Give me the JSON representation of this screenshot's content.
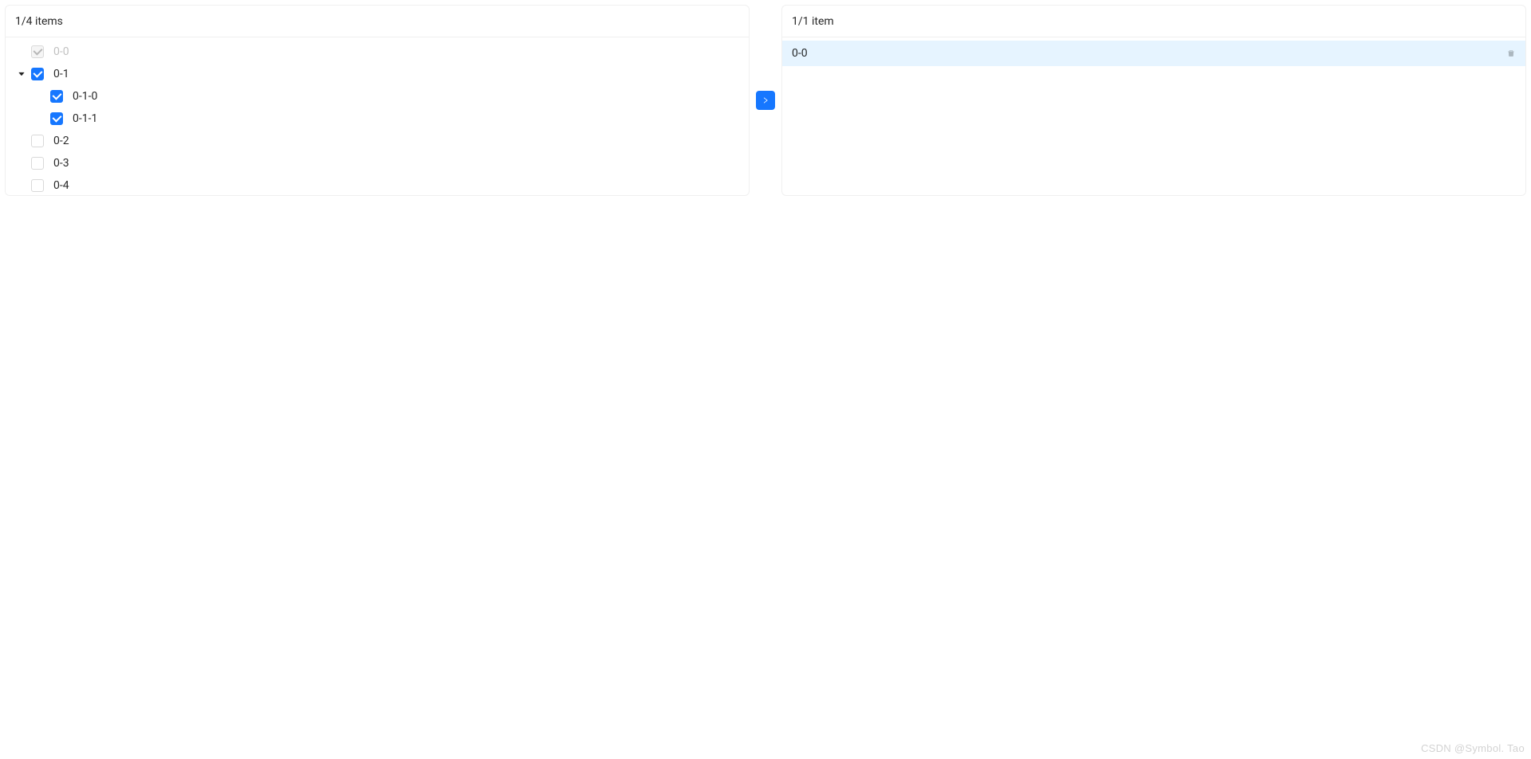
{
  "left": {
    "header": "1/4 items",
    "tree": [
      {
        "key": "0-0",
        "title": "0-0",
        "depth": 0,
        "switcher": "none",
        "checked": true,
        "disabled": true
      },
      {
        "key": "0-1",
        "title": "0-1",
        "depth": 0,
        "switcher": "open",
        "checked": true,
        "disabled": false
      },
      {
        "key": "0-1-0",
        "title": "0-1-0",
        "depth": 1,
        "switcher": "none",
        "checked": true,
        "disabled": false
      },
      {
        "key": "0-1-1",
        "title": "0-1-1",
        "depth": 1,
        "switcher": "none",
        "checked": true,
        "disabled": false
      },
      {
        "key": "0-2",
        "title": "0-2",
        "depth": 0,
        "switcher": "none",
        "checked": false,
        "disabled": false
      },
      {
        "key": "0-3",
        "title": "0-3",
        "depth": 0,
        "switcher": "none",
        "checked": false,
        "disabled": false
      },
      {
        "key": "0-4",
        "title": "0-4",
        "depth": 0,
        "switcher": "none",
        "checked": false,
        "disabled": false
      }
    ]
  },
  "right": {
    "header": "1/1 item",
    "items": [
      {
        "key": "0-0",
        "title": "0-0",
        "selected": true
      }
    ]
  },
  "watermark": "CSDN @Symbol. Tao"
}
